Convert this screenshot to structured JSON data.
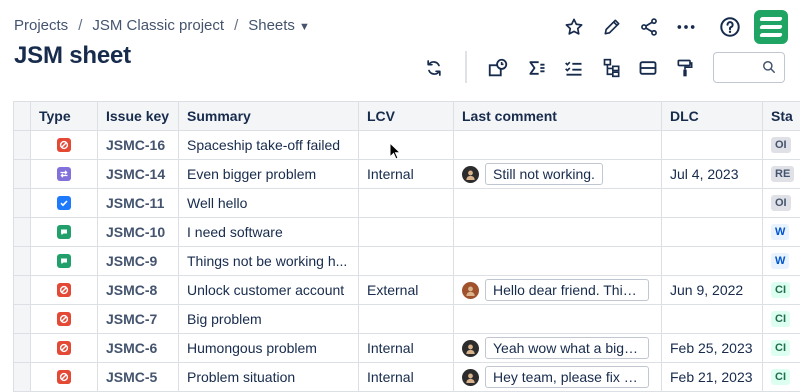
{
  "breadcrumbs": {
    "projects": "Projects",
    "project": "JSM Classic project",
    "sheets": "Sheets"
  },
  "page": {
    "title": "JSM sheet"
  },
  "colors": {
    "brand": "#1fa463",
    "error": "#e34935",
    "purple": "#8270db",
    "blue": "#1d7afc",
    "green": "#22a06b"
  },
  "toolbar": {
    "icons": [
      "star-icon",
      "pencil-icon",
      "share-icon",
      "more-icon",
      "help-icon",
      "app-logo",
      "refresh-icon",
      "filter-status-icon",
      "sum-icon",
      "checklist-icon",
      "hierarchy-icon",
      "group-icon",
      "paint-roller-icon",
      "search-icon"
    ],
    "search": {
      "value": "",
      "placeholder": ""
    }
  },
  "table": {
    "columns": [
      "Type",
      "Issue key",
      "Summary",
      "LCV",
      "Last comment",
      "DLC",
      "Sta"
    ],
    "rows": [
      {
        "type": "incident",
        "key": "JSMC-16",
        "summary": "Spaceship take-off failed",
        "lcv": "",
        "comment": "",
        "avatar": "",
        "dlc": "",
        "status": "OI"
      },
      {
        "type": "change",
        "key": "JSMC-14",
        "summary": "Even bigger problem",
        "lcv": "Internal",
        "comment": "Still not working.",
        "avatar": "dark",
        "dlc": "Jul 4, 2023",
        "status": "RE"
      },
      {
        "type": "task",
        "key": "JSMC-11",
        "summary": "Well hello",
        "lcv": "",
        "comment": "",
        "avatar": "",
        "dlc": "",
        "status": "OI"
      },
      {
        "type": "service",
        "key": "JSMC-10",
        "summary": "I need software",
        "lcv": "",
        "comment": "",
        "avatar": "",
        "dlc": "",
        "status": "W"
      },
      {
        "type": "service",
        "key": "JSMC-9",
        "summary": "Things not be working h...",
        "lcv": "",
        "comment": "",
        "avatar": "",
        "dlc": "",
        "status": "W"
      },
      {
        "type": "incident",
        "key": "JSMC-8",
        "summary": "Unlock customer account",
        "lcv": "External",
        "comment": "Hello dear friend. This ...",
        "avatar": "brown",
        "dlc": "Jun 9, 2022",
        "status": "CI"
      },
      {
        "type": "incident",
        "key": "JSMC-7",
        "summary": "Big problem",
        "lcv": "",
        "comment": "",
        "avatar": "",
        "dlc": "",
        "status": "CI"
      },
      {
        "type": "incident",
        "key": "JSMC-6",
        "summary": "Humongous problem",
        "lcv": "Internal",
        "comment": "Yeah wow what a big p...",
        "avatar": "dark",
        "dlc": "Feb 25, 2023",
        "status": "CI"
      },
      {
        "type": "incident",
        "key": "JSMC-5",
        "summary": "Problem situation",
        "lcv": "Internal",
        "comment": "Hey team, please fix s...",
        "avatar": "dark",
        "dlc": "Feb 21, 2023",
        "status": "CI"
      }
    ]
  }
}
